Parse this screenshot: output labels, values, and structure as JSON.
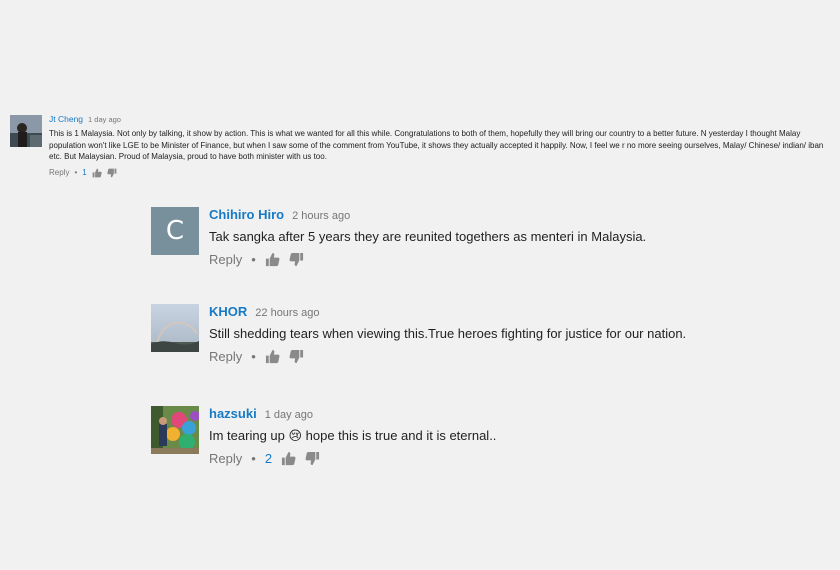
{
  "comments": [
    {
      "author": "Jt Cheng",
      "time": "1 day ago",
      "text": "This is 1 Malaysia. Not only by talking, it show by action. This is what we wanted for all this while. Congratulations to both of them, hopefully they will bring our country to a better future. N yesterday I thought Malay population won't like LGE to be Minister of Finance, but when I saw some of the comment from YouTube, it shows they actually accepted it happily. Now, I feel we r no more seeing ourselves, Malay/ Chinese/ indian/ iban etc. But Malaysian. Proud of Malaysia, proud to have both minister with us too.",
      "reply_label": "Reply",
      "separator": "•",
      "likes": "1"
    },
    {
      "author": "Chihiro Hiro",
      "time": "2 hours ago",
      "avatar_letter": "C",
      "text": "Tak sangka after 5 years they are reunited togethers as menteri in Malaysia.",
      "reply_label": "Reply",
      "separator": "•"
    },
    {
      "author": "KHOR",
      "time": "22 hours ago",
      "text": "Still shedding tears when viewing this.True heroes fighting for justice for our nation.",
      "reply_label": "Reply",
      "separator": "•"
    },
    {
      "author": "hazsuki",
      "time": "1 day ago",
      "text": "Im tearing up 😢 hope this is true and it is eternal..",
      "reply_label": "Reply",
      "separator": "•",
      "likes": "2"
    }
  ],
  "icons": {
    "like": "thumbs-up-icon",
    "dislike": "thumbs-down-icon"
  },
  "colors": {
    "author": "#167ac6",
    "icon": "#8a8a8a",
    "background": "#f1f1f1"
  }
}
